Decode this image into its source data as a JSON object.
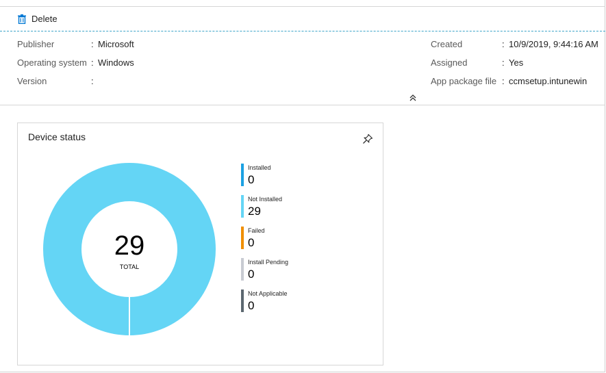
{
  "toolbar": {
    "delete_label": "Delete"
  },
  "essentials": {
    "left": [
      {
        "label": "Publisher",
        "value": "Microsoft"
      },
      {
        "label": "Operating system",
        "value": "Windows"
      },
      {
        "label": "Version",
        "value": ""
      }
    ],
    "right": [
      {
        "label": "Created",
        "value": "10/9/2019, 9:44:16 AM"
      },
      {
        "label": "Assigned",
        "value": "Yes"
      },
      {
        "label": "App package file",
        "value": "ccmsetup.intunewin"
      }
    ],
    "separator": ":"
  },
  "device_status": {
    "title": "Device status",
    "total_value": "29",
    "total_label": "TOTAL",
    "legend": [
      {
        "name": "Installed",
        "value": "0",
        "color": "#1ba1e2"
      },
      {
        "name": "Not Installed",
        "value": "29",
        "color": "#64d5f5"
      },
      {
        "name": "Failed",
        "value": "0",
        "color": "#f08f00"
      },
      {
        "name": "Install Pending",
        "value": "0",
        "color": "#c8cbd2"
      },
      {
        "name": "Not Applicable",
        "value": "0",
        "color": "#5c6770"
      }
    ]
  },
  "icons": {
    "delete": "trash-icon",
    "collapse": "double-chevron-up-icon",
    "pin": "pin-icon"
  }
}
